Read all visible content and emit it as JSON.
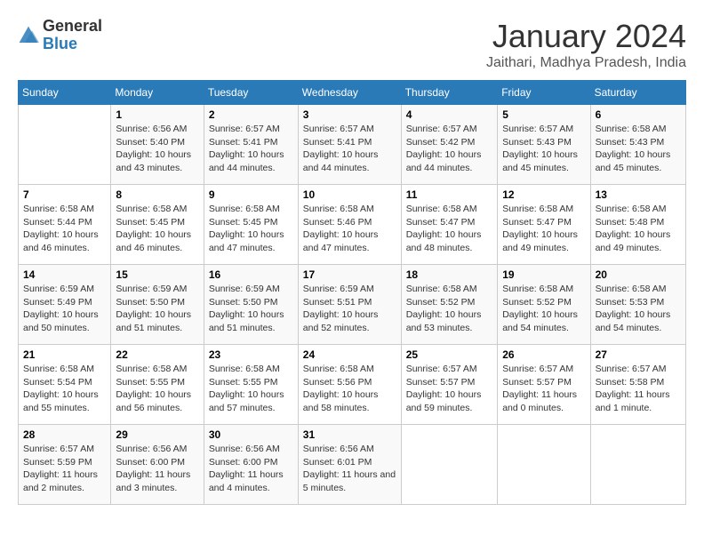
{
  "header": {
    "logo_general": "General",
    "logo_blue": "Blue",
    "month_year": "January 2024",
    "location": "Jaithari, Madhya Pradesh, India"
  },
  "weekdays": [
    "Sunday",
    "Monday",
    "Tuesday",
    "Wednesday",
    "Thursday",
    "Friday",
    "Saturday"
  ],
  "weeks": [
    [
      {
        "day": "",
        "sunrise": "",
        "sunset": "",
        "daylight": ""
      },
      {
        "day": "1",
        "sunrise": "Sunrise: 6:56 AM",
        "sunset": "Sunset: 5:40 PM",
        "daylight": "Daylight: 10 hours and 43 minutes."
      },
      {
        "day": "2",
        "sunrise": "Sunrise: 6:57 AM",
        "sunset": "Sunset: 5:41 PM",
        "daylight": "Daylight: 10 hours and 44 minutes."
      },
      {
        "day": "3",
        "sunrise": "Sunrise: 6:57 AM",
        "sunset": "Sunset: 5:41 PM",
        "daylight": "Daylight: 10 hours and 44 minutes."
      },
      {
        "day": "4",
        "sunrise": "Sunrise: 6:57 AM",
        "sunset": "Sunset: 5:42 PM",
        "daylight": "Daylight: 10 hours and 44 minutes."
      },
      {
        "day": "5",
        "sunrise": "Sunrise: 6:57 AM",
        "sunset": "Sunset: 5:43 PM",
        "daylight": "Daylight: 10 hours and 45 minutes."
      },
      {
        "day": "6",
        "sunrise": "Sunrise: 6:58 AM",
        "sunset": "Sunset: 5:43 PM",
        "daylight": "Daylight: 10 hours and 45 minutes."
      }
    ],
    [
      {
        "day": "7",
        "sunrise": "Sunrise: 6:58 AM",
        "sunset": "Sunset: 5:44 PM",
        "daylight": "Daylight: 10 hours and 46 minutes."
      },
      {
        "day": "8",
        "sunrise": "Sunrise: 6:58 AM",
        "sunset": "Sunset: 5:45 PM",
        "daylight": "Daylight: 10 hours and 46 minutes."
      },
      {
        "day": "9",
        "sunrise": "Sunrise: 6:58 AM",
        "sunset": "Sunset: 5:45 PM",
        "daylight": "Daylight: 10 hours and 47 minutes."
      },
      {
        "day": "10",
        "sunrise": "Sunrise: 6:58 AM",
        "sunset": "Sunset: 5:46 PM",
        "daylight": "Daylight: 10 hours and 47 minutes."
      },
      {
        "day": "11",
        "sunrise": "Sunrise: 6:58 AM",
        "sunset": "Sunset: 5:47 PM",
        "daylight": "Daylight: 10 hours and 48 minutes."
      },
      {
        "day": "12",
        "sunrise": "Sunrise: 6:58 AM",
        "sunset": "Sunset: 5:47 PM",
        "daylight": "Daylight: 10 hours and 49 minutes."
      },
      {
        "day": "13",
        "sunrise": "Sunrise: 6:58 AM",
        "sunset": "Sunset: 5:48 PM",
        "daylight": "Daylight: 10 hours and 49 minutes."
      }
    ],
    [
      {
        "day": "14",
        "sunrise": "Sunrise: 6:59 AM",
        "sunset": "Sunset: 5:49 PM",
        "daylight": "Daylight: 10 hours and 50 minutes."
      },
      {
        "day": "15",
        "sunrise": "Sunrise: 6:59 AM",
        "sunset": "Sunset: 5:50 PM",
        "daylight": "Daylight: 10 hours and 51 minutes."
      },
      {
        "day": "16",
        "sunrise": "Sunrise: 6:59 AM",
        "sunset": "Sunset: 5:50 PM",
        "daylight": "Daylight: 10 hours and 51 minutes."
      },
      {
        "day": "17",
        "sunrise": "Sunrise: 6:59 AM",
        "sunset": "Sunset: 5:51 PM",
        "daylight": "Daylight: 10 hours and 52 minutes."
      },
      {
        "day": "18",
        "sunrise": "Sunrise: 6:58 AM",
        "sunset": "Sunset: 5:52 PM",
        "daylight": "Daylight: 10 hours and 53 minutes."
      },
      {
        "day": "19",
        "sunrise": "Sunrise: 6:58 AM",
        "sunset": "Sunset: 5:52 PM",
        "daylight": "Daylight: 10 hours and 54 minutes."
      },
      {
        "day": "20",
        "sunrise": "Sunrise: 6:58 AM",
        "sunset": "Sunset: 5:53 PM",
        "daylight": "Daylight: 10 hours and 54 minutes."
      }
    ],
    [
      {
        "day": "21",
        "sunrise": "Sunrise: 6:58 AM",
        "sunset": "Sunset: 5:54 PM",
        "daylight": "Daylight: 10 hours and 55 minutes."
      },
      {
        "day": "22",
        "sunrise": "Sunrise: 6:58 AM",
        "sunset": "Sunset: 5:55 PM",
        "daylight": "Daylight: 10 hours and 56 minutes."
      },
      {
        "day": "23",
        "sunrise": "Sunrise: 6:58 AM",
        "sunset": "Sunset: 5:55 PM",
        "daylight": "Daylight: 10 hours and 57 minutes."
      },
      {
        "day": "24",
        "sunrise": "Sunrise: 6:58 AM",
        "sunset": "Sunset: 5:56 PM",
        "daylight": "Daylight: 10 hours and 58 minutes."
      },
      {
        "day": "25",
        "sunrise": "Sunrise: 6:57 AM",
        "sunset": "Sunset: 5:57 PM",
        "daylight": "Daylight: 10 hours and 59 minutes."
      },
      {
        "day": "26",
        "sunrise": "Sunrise: 6:57 AM",
        "sunset": "Sunset: 5:57 PM",
        "daylight": "Daylight: 11 hours and 0 minutes."
      },
      {
        "day": "27",
        "sunrise": "Sunrise: 6:57 AM",
        "sunset": "Sunset: 5:58 PM",
        "daylight": "Daylight: 11 hours and 1 minute."
      }
    ],
    [
      {
        "day": "28",
        "sunrise": "Sunrise: 6:57 AM",
        "sunset": "Sunset: 5:59 PM",
        "daylight": "Daylight: 11 hours and 2 minutes."
      },
      {
        "day": "29",
        "sunrise": "Sunrise: 6:56 AM",
        "sunset": "Sunset: 6:00 PM",
        "daylight": "Daylight: 11 hours and 3 minutes."
      },
      {
        "day": "30",
        "sunrise": "Sunrise: 6:56 AM",
        "sunset": "Sunset: 6:00 PM",
        "daylight": "Daylight: 11 hours and 4 minutes."
      },
      {
        "day": "31",
        "sunrise": "Sunrise: 6:56 AM",
        "sunset": "Sunset: 6:01 PM",
        "daylight": "Daylight: 11 hours and 5 minutes."
      },
      {
        "day": "",
        "sunrise": "",
        "sunset": "",
        "daylight": ""
      },
      {
        "day": "",
        "sunrise": "",
        "sunset": "",
        "daylight": ""
      },
      {
        "day": "",
        "sunrise": "",
        "sunset": "",
        "daylight": ""
      }
    ]
  ]
}
